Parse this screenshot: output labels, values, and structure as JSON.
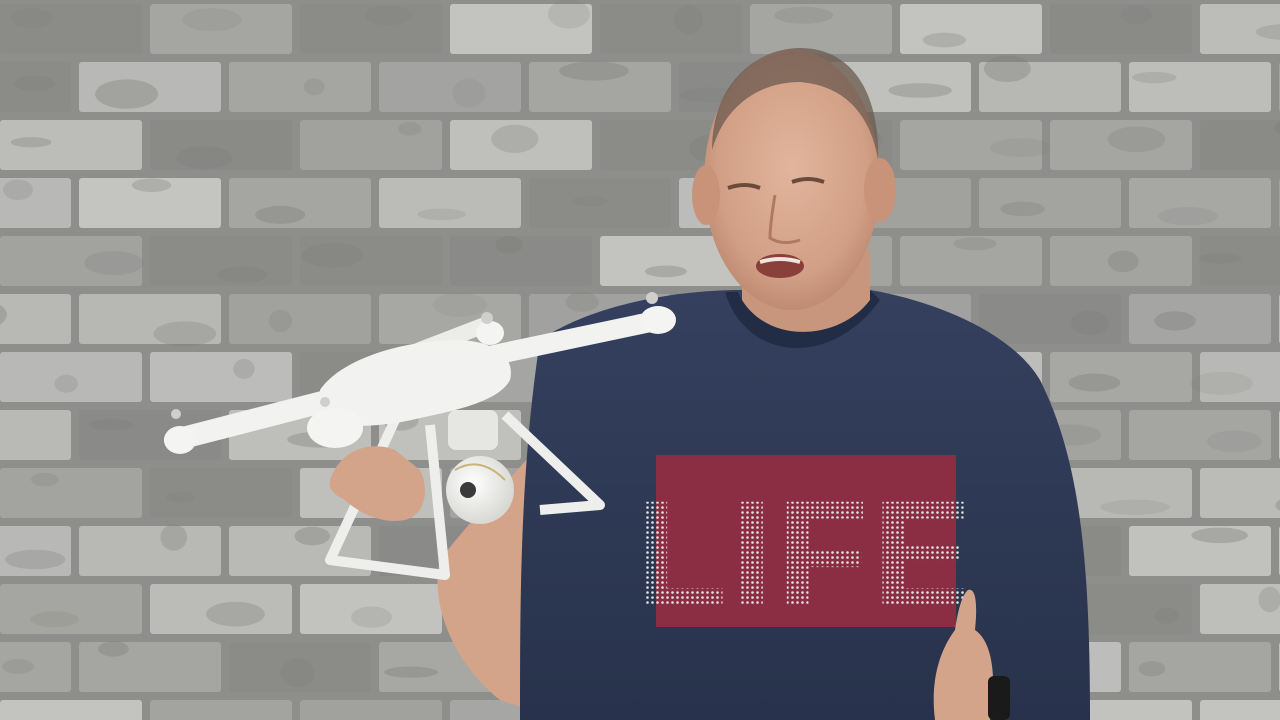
{
  "scene": {
    "type": "video-frame",
    "subject": "man-holding-drone"
  },
  "shirt": {
    "text": "LIFE",
    "patch_color": "#8c2e43",
    "text_color": "#d9d9d9",
    "shirt_color": "#2e3a56"
  },
  "colors": {
    "wall_mortar": "#8e8e8c",
    "brick_light": "#c4c4c1",
    "brick_mid": "#a7a7a4",
    "brick_dark": "#8a8a87",
    "skin": "#d7a88e",
    "drone_white": "#f2f2f0"
  }
}
